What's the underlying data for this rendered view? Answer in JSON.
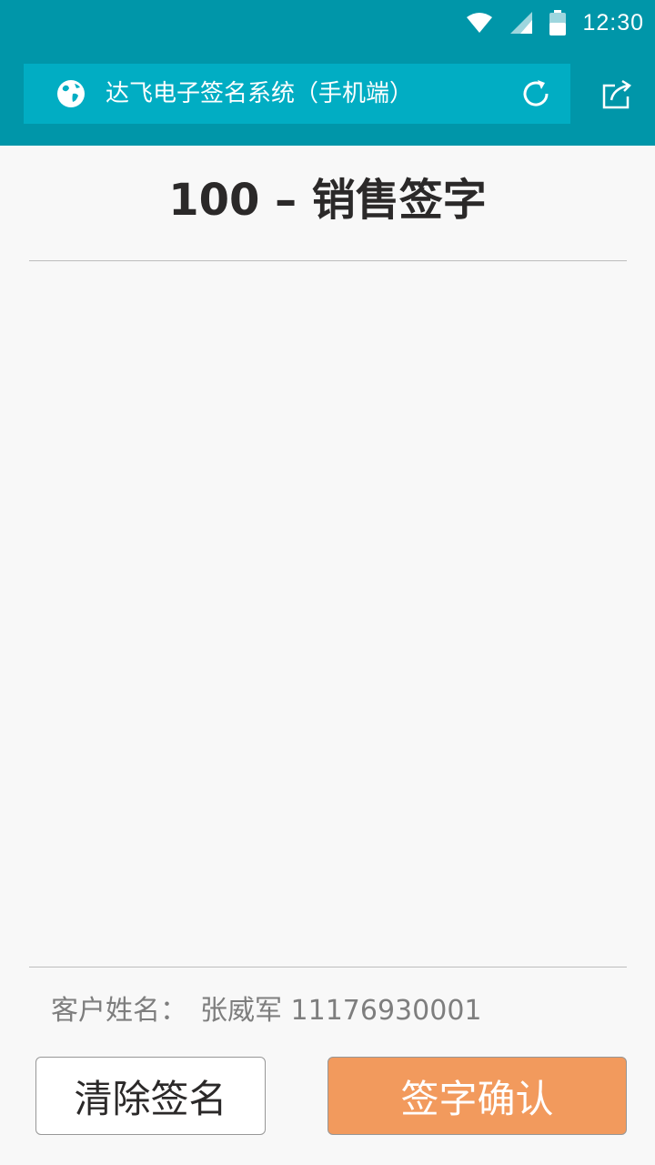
{
  "status_bar": {
    "time": "12:30",
    "icons": [
      "wifi-icon",
      "cellular-signal-icon",
      "battery-icon"
    ]
  },
  "toolbar": {
    "title": "达飞电子签名系统（手机端）",
    "icons": [
      "globe-icon",
      "reload-icon",
      "share-icon"
    ]
  },
  "page": {
    "title": "100 – 销售签字"
  },
  "signature_pad": {
    "label": ""
  },
  "customer": {
    "label": "客户姓名：",
    "name_id": "张威军 11176930001"
  },
  "buttons": {
    "clear_label": "清除签名",
    "confirm_label": "签字确认"
  },
  "colors": {
    "app_bar": "#0096A9",
    "address_bar": "#01ADC3",
    "title_text": "#2B2929",
    "muted_text": "#7E7E7E",
    "confirm_fill": "#F29A5D",
    "button_border": "#979797"
  }
}
